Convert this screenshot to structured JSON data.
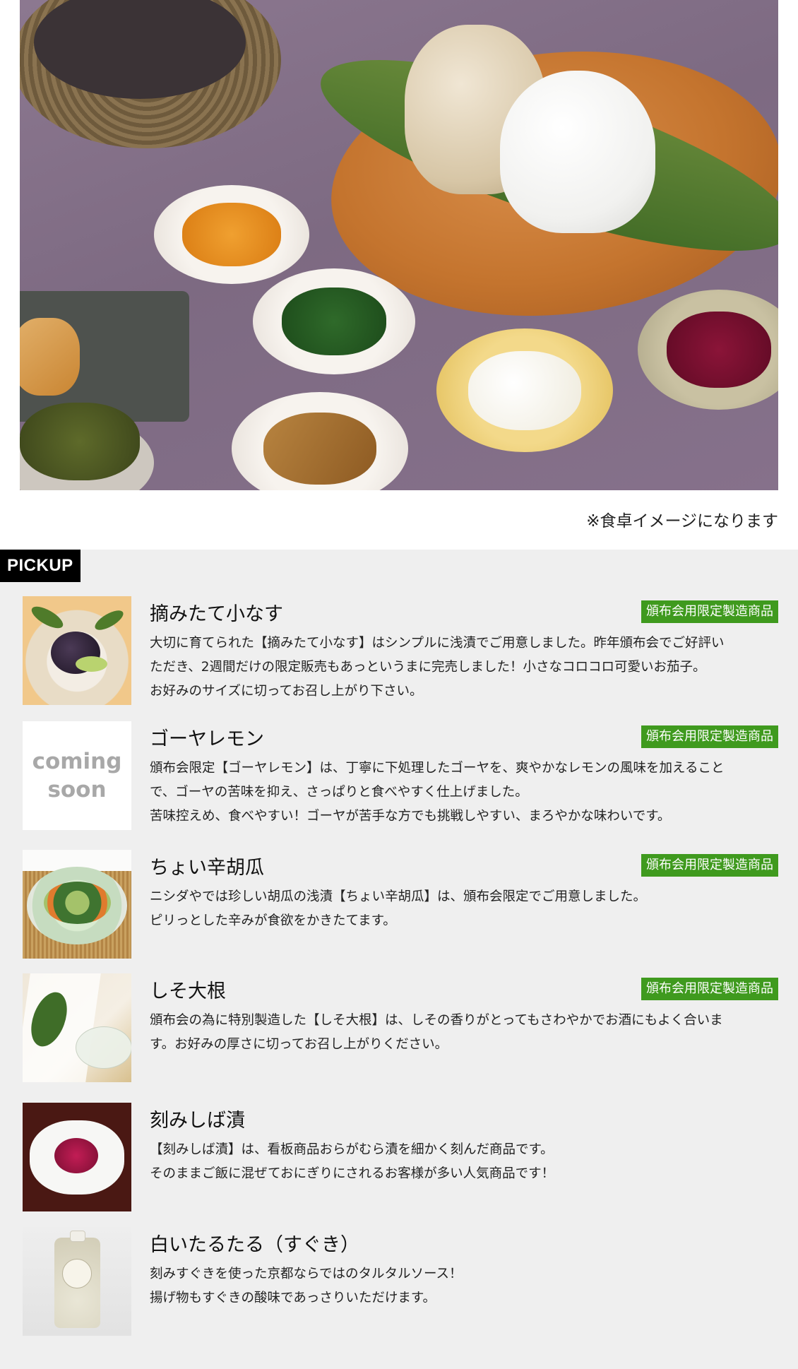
{
  "caption": "※食卓イメージになります",
  "pickup": {
    "label": "PICKUP",
    "items": [
      {
        "title": "摘みたて小なす",
        "badge": "頒布会用限定製造商品",
        "desc": [
          "大切に育てられた【摘みたて小なす】はシンプルに浅漬でご用意しました。昨年頒布会でご好評い",
          "ただき、2週間だけの限定販売もあっというまに完売しました！小さなコロコロ可愛いお茄子。",
          "お好みのサイズに切ってお召し上がり下さい。"
        ]
      },
      {
        "title": "ゴーヤレモン",
        "badge": "頒布会用限定製造商品",
        "thumb_text": [
          "coming",
          "soon"
        ],
        "desc": [
          "頒布会限定【ゴーヤレモン】は、丁寧に下処理したゴーヤを、爽やかなレモンの風味を加えること",
          "で、ゴーヤの苦味を抑え、さっぱりと食べやすく仕上げました。",
          "苦味控えめ、食べやすい！ゴーヤが苦手な方でも挑戦しやすい、まろやかな味わいです。"
        ]
      },
      {
        "title": "ちょい辛胡瓜",
        "badge": "頒布会用限定製造商品",
        "desc": [
          "ニシダやでは珍しい胡瓜の浅漬【ちょい辛胡瓜】は、頒布会限定でご用意しました。",
          "ピリっとした辛みが食欲をかきたてます。"
        ]
      },
      {
        "title": "しそ大根",
        "badge": "頒布会用限定製造商品",
        "desc": [
          "頒布会の為に特別製造した【しそ大根】は、しその香りがとってもさわやかでお酒にもよく合いま",
          "す。お好みの厚さに切ってお召し上がりください。"
        ]
      },
      {
        "title": "刻みしば漬",
        "desc": [
          "【刻みしば漬】は、看板商品おらがむら漬を細かく刻んだ商品です。",
          "そのままご飯に混ぜておにぎりにされるお客様が多い人気商品です！"
        ]
      },
      {
        "title": "白いたるたる（すぐき）",
        "desc": [
          "刻みすぐきを使った京都ならではのタルタルソース！",
          "揚げ物もすぐきの酸味であっさりいただけます。"
        ]
      }
    ]
  },
  "colors": {
    "badge": "#3f9a1e",
    "section_bg": "#efefef",
    "pickup_label_bg": "#000000"
  },
  "icons": [
    "hero-photo",
    "product-thumbnail"
  ]
}
